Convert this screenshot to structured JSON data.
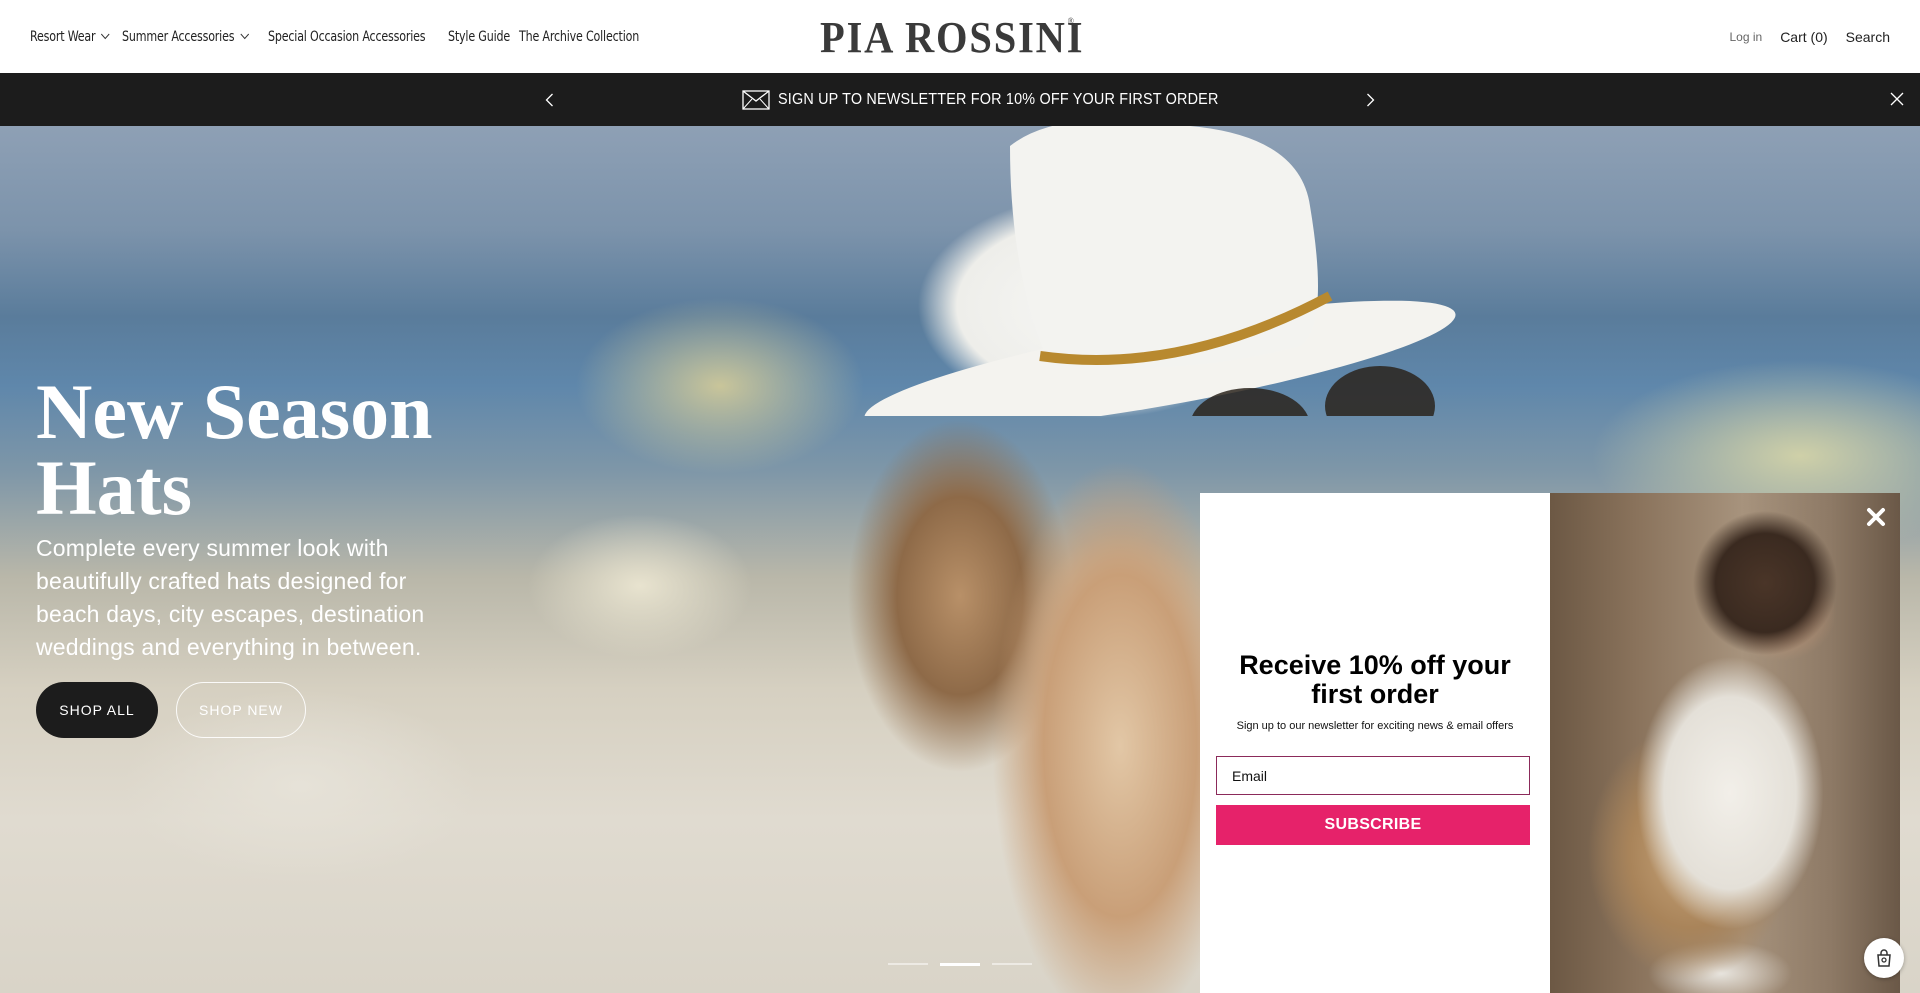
{
  "header": {
    "nav": [
      {
        "label": "Resort Wear",
        "has_dropdown": true
      },
      {
        "label": "Summer Accessories",
        "has_dropdown": true
      },
      {
        "label": "Special Occasion Accessories",
        "has_dropdown": false
      },
      {
        "label": "Style Guide",
        "has_dropdown": false
      },
      {
        "label": "The Archive Collection",
        "has_dropdown": false
      }
    ],
    "logo": "PIA ROSSINI",
    "logo_mark": "®",
    "login": "Log in",
    "cart": "Cart (0)",
    "search": "Search"
  },
  "announcement": {
    "text": "SIGN UP TO NEWSLETTER FOR 10% OFF YOUR FIRST ORDER",
    "icon": "envelope-icon"
  },
  "hero": {
    "title_line1": "New Season",
    "title_line2": "Hats",
    "subtitle": "Complete every summer look with beautifully crafted hats designed for beach days, city escapes, destination weddings and everything in between.",
    "primary_button": "SHOP ALL",
    "secondary_button": "SHOP NEW",
    "slide_count": 3,
    "active_slide": 2
  },
  "popup": {
    "heading": "Receive 10% off your first order",
    "subtext": "Sign up to our newsletter for exciting news & email offers",
    "email_placeholder": "Email",
    "subscribe_label": "SUBSCRIBE",
    "accent_color": "#e6226a"
  },
  "colors": {
    "announcement_bg": "#1c1c1c",
    "shop_all_bg": "#1c1c1c",
    "text_dark": "#222222"
  }
}
